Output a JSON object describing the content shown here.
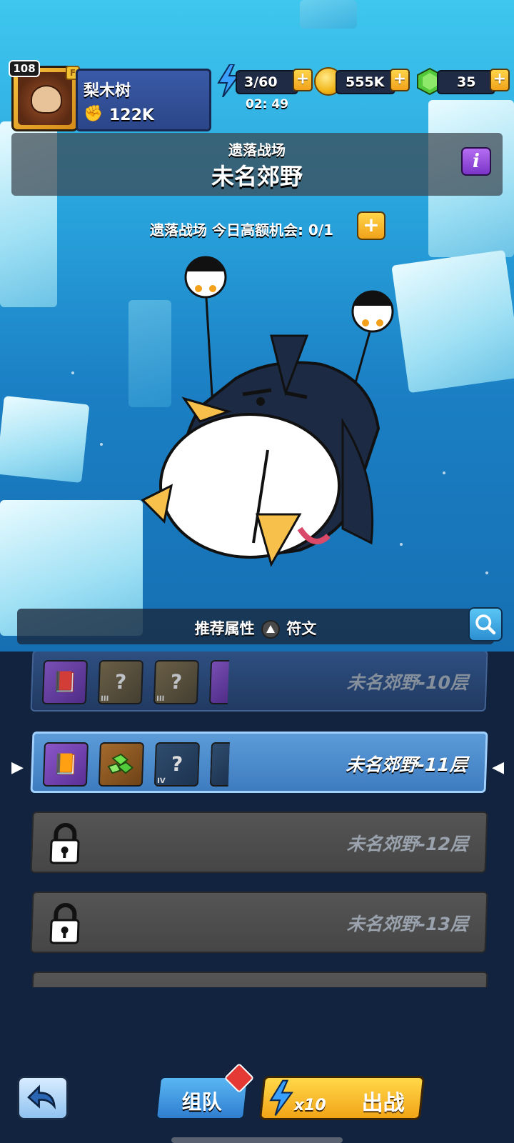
{
  "player": {
    "level": "108",
    "name": "梨木树",
    "power": "122K",
    "badge": "F"
  },
  "resources": {
    "energy": "3/60",
    "energy_timer": "02: 49",
    "coins": "555K",
    "gems": "35",
    "plus": "+"
  },
  "stage": {
    "category": "遗落战场",
    "title": "未名郊野",
    "info_label": "i",
    "chance_text": "遗落战场 今日高额机会: 0/1",
    "chance_plus": "+"
  },
  "recommend": {
    "prefix": "推荐属性",
    "suffix": "符文"
  },
  "floors": [
    {
      "label": "未名郊野-10层",
      "state": "dim",
      "rewards": [
        {
          "type": "book",
          "glyph": "",
          "tag": ""
        },
        {
          "type": "qbrown",
          "glyph": "?",
          "tag": "III"
        },
        {
          "type": "qbrown",
          "glyph": "?",
          "tag": "III"
        }
      ]
    },
    {
      "label": "未名郊野-11层",
      "state": "active",
      "rewards": [
        {
          "type": "book",
          "glyph": "",
          "tag": ""
        },
        {
          "type": "gem",
          "glyph": "",
          "tag": ""
        },
        {
          "type": "q",
          "glyph": "?",
          "tag": "IV"
        }
      ]
    },
    {
      "label": "未名郊野-12层",
      "state": "locked",
      "rewards": []
    },
    {
      "label": "未名郊野-13层",
      "state": "locked",
      "rewards": []
    }
  ],
  "bottom": {
    "team_label": "组队",
    "battle_label": "出战",
    "battle_cost": "x10"
  },
  "icons": {
    "energy": "lightning-bolt-icon",
    "coin": "gold-coin-icon",
    "gem": "green-gem-icon",
    "lock": "padlock-icon",
    "search": "magnifier-icon",
    "back": "back-arrow-icon"
  },
  "colors": {
    "accent_yellow": "#f0a21a",
    "accent_blue": "#3e7cc0",
    "background": "#12233f"
  }
}
